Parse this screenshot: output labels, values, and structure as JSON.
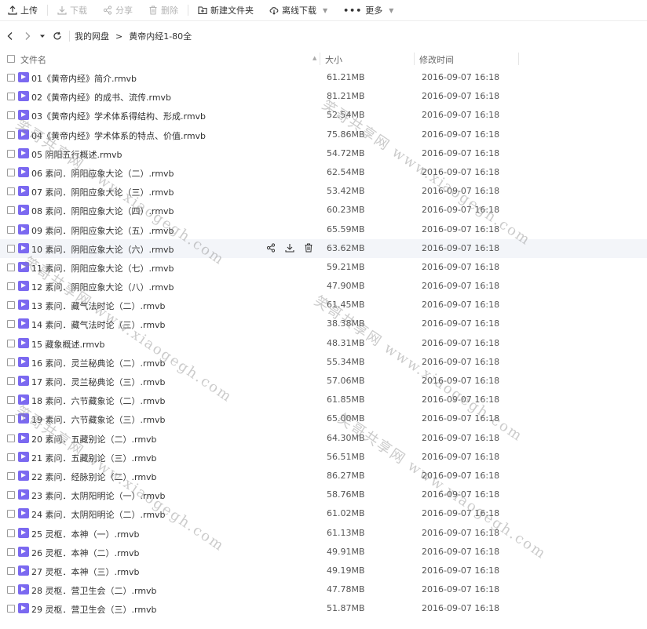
{
  "toolbar": {
    "upload": "上传",
    "download": "下载",
    "share": "分享",
    "delete": "删除",
    "new_folder": "新建文件夹",
    "offline_download": "离线下载",
    "more": "更多"
  },
  "breadcrumb": {
    "root": "我的网盘",
    "current": "黄帝内经1-80全"
  },
  "columns": {
    "name": "文件名",
    "size": "大小",
    "modified": "修改时间"
  },
  "files": [
    {
      "name": "01《黄帝内经》简介.rmvb",
      "size": "61.21MB",
      "date": "2016-09-07 16:18"
    },
    {
      "name": "02《黄帝内经》的成书、流传.rmvb",
      "size": "81.21MB",
      "date": "2016-09-07 16:18"
    },
    {
      "name": "03《黄帝内经》学术体系得结构、形成.rmvb",
      "size": "52.54MB",
      "date": "2016-09-07 16:18"
    },
    {
      "name": "04《黄帝内经》学术体系的特点、价值.rmvb",
      "size": "75.86MB",
      "date": "2016-09-07 16:18"
    },
    {
      "name": "05 阴阳五行概述.rmvb",
      "size": "54.72MB",
      "date": "2016-09-07 16:18"
    },
    {
      "name": "06 素问．阴阳应象大论（二）.rmvb",
      "size": "62.54MB",
      "date": "2016-09-07 16:18"
    },
    {
      "name": "07 素问．阴阳应象大论（三）.rmvb",
      "size": "53.42MB",
      "date": "2016-09-07 16:18"
    },
    {
      "name": "08 素问．阴阳应象大论（四）.rmvb",
      "size": "60.23MB",
      "date": "2016-09-07 16:18"
    },
    {
      "name": "09 素问．阴阳应象大论（五）.rmvb",
      "size": "65.59MB",
      "date": "2016-09-07 16:18"
    },
    {
      "name": "10 素问．阴阳应象大论（六）.rmvb",
      "size": "63.62MB",
      "date": "2016-09-07 16:18"
    },
    {
      "name": "11 素问．阴阳应象大论（七）.rmvb",
      "size": "59.21MB",
      "date": "2016-09-07 16:18"
    },
    {
      "name": "12 素问．阴阳应象大论（八）.rmvb",
      "size": "47.90MB",
      "date": "2016-09-07 16:18"
    },
    {
      "name": "13 素问．藏气法时论（二）.rmvb",
      "size": "61.45MB",
      "date": "2016-09-07 16:18"
    },
    {
      "name": "14 素问．藏气法时论（三）.rmvb",
      "size": "38.38MB",
      "date": "2016-09-07 16:18"
    },
    {
      "name": "15 藏象概述.rmvb",
      "size": "48.31MB",
      "date": "2016-09-07 16:18"
    },
    {
      "name": "16 素问．灵兰秘典论（二）.rmvb",
      "size": "55.34MB",
      "date": "2016-09-07 16:18"
    },
    {
      "name": "17 素问．灵兰秘典论（三）.rmvb",
      "size": "57.06MB",
      "date": "2016-09-07 16:18"
    },
    {
      "name": "18 素问．六节藏象论（二）.rmvb",
      "size": "61.85MB",
      "date": "2016-09-07 16:18"
    },
    {
      "name": "19 素问．六节藏象论（三）.rmvb",
      "size": "65.00MB",
      "date": "2016-09-07 16:18"
    },
    {
      "name": "20 素问．五藏别论（二）.rmvb",
      "size": "64.30MB",
      "date": "2016-09-07 16:18"
    },
    {
      "name": "21 素问．五藏别论（三）.rmvb",
      "size": "56.51MB",
      "date": "2016-09-07 16:18"
    },
    {
      "name": "22 素问．经脉别论（二）.rmvb",
      "size": "86.27MB",
      "date": "2016-09-07 16:18"
    },
    {
      "name": "23 素问．太阴阳明论（一）.rmvb",
      "size": "58.76MB",
      "date": "2016-09-07 16:18"
    },
    {
      "name": "24 素问．太阴阳明论（二）.rmvb",
      "size": "61.02MB",
      "date": "2016-09-07 16:18"
    },
    {
      "name": "25 灵枢．本神（一）.rmvb",
      "size": "61.13MB",
      "date": "2016-09-07 16:18"
    },
    {
      "name": "26 灵枢．本神（二）.rmvb",
      "size": "49.91MB",
      "date": "2016-09-07 16:18"
    },
    {
      "name": "27 灵枢．本神（三）.rmvb",
      "size": "49.19MB",
      "date": "2016-09-07 16:18"
    },
    {
      "name": "28 灵枢．营卫生会（二）.rmvb",
      "size": "47.78MB",
      "date": "2016-09-07 16:18"
    },
    {
      "name": "29 灵枢．营卫生会（三）.rmvb",
      "size": "51.87MB",
      "date": "2016-09-07 16:18"
    }
  ],
  "hover_row_index": 9,
  "watermark": "笑哥共享网 www.xiaogegh.com",
  "colors": {
    "file_icon": "#7b69f0",
    "hover_row": "#f3f5f9"
  }
}
